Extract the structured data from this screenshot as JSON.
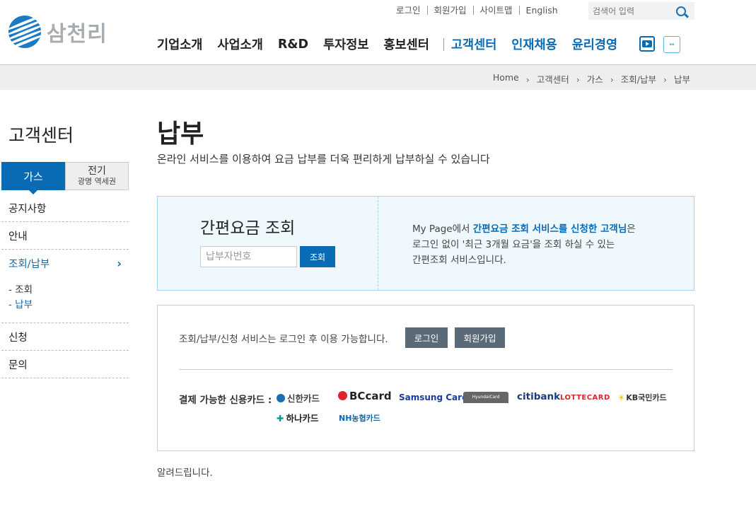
{
  "header": {
    "logo_text": "삼천리",
    "util_links": [
      "로그인",
      "회원가입",
      "사이트맵",
      "English"
    ],
    "search": {
      "placeholder": "검색어 입력"
    },
    "nav": [
      "기업소개",
      "사업소개",
      "R&D",
      "투자정보",
      "홍보센터"
    ],
    "nav_highlight": [
      "고객센터",
      "인재채용",
      "윤리경영"
    ],
    "sns": [
      "youtube-icon",
      "happy-ad-icon"
    ]
  },
  "breadcrumb": [
    "Home",
    "고객센터",
    "가스",
    "조회/납부",
    "납부"
  ],
  "sidebar": {
    "title": "고객센터",
    "tab_gas": "가스",
    "tab_elec": "전기",
    "tab_elec_sub": "광명 역세권",
    "items": [
      "공지사항",
      "안내",
      "조회/납부",
      "신청",
      "문의"
    ],
    "sub_items": [
      "조회",
      "납부"
    ]
  },
  "main": {
    "title": "납부",
    "description": "온라인 서비스를 이용하여 요금 납부를 더욱 편리하게 납부하실 수 있습니다",
    "quick": {
      "title": "간편요금 조회",
      "input_placeholder": "납부자번호",
      "button": "조회",
      "info_prefix": "My Page에서 ",
      "info_highlight": "간편요금 조회 서비스를 신청한 고객님",
      "info_suffix": "은",
      "info_line2": "로그인 없이 '최근 3개월 요금'을 조회 하실 수 있는",
      "info_line3": "간편조회 서비스입니다."
    },
    "login_box": {
      "text": "조회/납부/신청 서비스는 로그인 후 이용 가능합니다.",
      "login_button": "로그인",
      "join_button": "회원가입",
      "cards_label": "결제 가능한 신용카드 :",
      "cards": [
        "신한카드",
        "BCcard",
        "Samsung Card",
        "HyundaiCard",
        "citibank",
        "LOTTECARD",
        "KB국민카드",
        "하나카드",
        "NH농협카드"
      ]
    },
    "notice": "알려드립니다."
  },
  "colors": {
    "brand_blue": "#0a6bb5",
    "button_gray": "#5a6a78",
    "quick_bg": "#eef8fd"
  }
}
